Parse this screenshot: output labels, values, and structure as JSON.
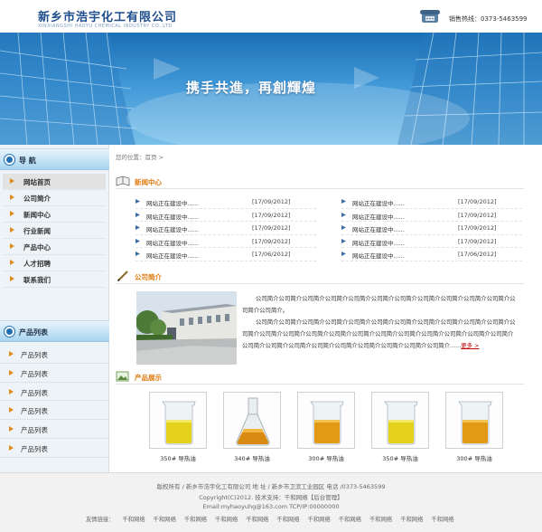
{
  "header": {
    "logo_cn": "新乡市浩宇化工有限公司",
    "logo_en": "XINXIANGSHI HAOYU CHEMICAL INDUSTRY CO.,LTD",
    "hotline": "销售热线：0373-5463599"
  },
  "banner": {
    "slogan": "携手共進，再創輝煌"
  },
  "sidebar": {
    "nav_title": "导  航",
    "nav_items": [
      {
        "label": "网站首页"
      },
      {
        "label": "公司简介"
      },
      {
        "label": "新闻中心"
      },
      {
        "label": "行业新闻"
      },
      {
        "label": "产品中心"
      },
      {
        "label": "人才招聘"
      },
      {
        "label": "联系我们"
      }
    ],
    "product_title": "产品列表",
    "product_items": [
      {
        "label": "产品列表"
      },
      {
        "label": "产品列表"
      },
      {
        "label": "产品列表"
      },
      {
        "label": "产品列表"
      },
      {
        "label": "产品列表"
      },
      {
        "label": "产品列表"
      }
    ]
  },
  "breadcrumb": "您的位置：首页 >",
  "news": {
    "title": "新闻中心",
    "left": [
      {
        "title": "网站正在建设中......",
        "date": "[17/09/2012]"
      },
      {
        "title": "网站正在建设中......",
        "date": "[17/09/2012]"
      },
      {
        "title": "网站正在建设中......",
        "date": "[17/09/2012]"
      },
      {
        "title": "网站正在建设中......",
        "date": "[17/09/2012]"
      },
      {
        "title": "网站正在建设中......",
        "date": "[17/06/2012]"
      }
    ],
    "right": [
      {
        "title": "网站正在建设中......",
        "date": "[17/09/2012]"
      },
      {
        "title": "网站正在建设中......",
        "date": "[17/09/2012]"
      },
      {
        "title": "网站正在建设中......",
        "date": "[17/09/2012]"
      },
      {
        "title": "网站正在建设中......",
        "date": "[17/09/2012]"
      },
      {
        "title": "网站正在建设中......",
        "date": "[17/06/2012]"
      }
    ]
  },
  "about": {
    "title": "公司简介",
    "para1": "公司简介公司简介公司简介公司简介公司简介公司简介公司简介公司简介公司简介公司简介公司简介公司简介公司简介。",
    "para2": "公司简介公司简介公司简介公司简介公司简介公司简介公司简介公司简介公司简介公司简介公司简介公司简介公司简介公司简介公司简介公司简介公司简介公司简介公司简介公司简介公司简介公司简介公司简介公司简介公司简介公司简介公司简介公司简介公司简介公司简介公司简介公司简介......",
    "more": "更多 >"
  },
  "products": {
    "title": "产品展示",
    "items": [
      {
        "name": "350# 导热油"
      },
      {
        "name": "340# 导热油"
      },
      {
        "name": "300# 导热油"
      },
      {
        "name": "350# 导热油"
      },
      {
        "name": "300# 导热油"
      }
    ]
  },
  "footer": {
    "line1": "版权所有 / 新乡市浩宇化工有限公司    地  址 / 新乡市卫滨工业园区      电话 /0373-5463599",
    "line2": "Copyright(C)2012. 技术支持：千和网络【后台管理】",
    "line3": "Email:myhaoyuhg@163.com  TCP/IP:00000000",
    "links_label": "友情链接：",
    "links": [
      "千和网络",
      "千和网络",
      "千和网络",
      "千和网络",
      "千和网络",
      "千和网络",
      "千和网络",
      "千和网络",
      "千和网络",
      "千和网络",
      "千和网络",
      "千和网络"
    ]
  },
  "colors": {
    "brand_blue": "#1f4e8c",
    "accent_orange": "#e07a10",
    "more_red": "#c00000"
  }
}
